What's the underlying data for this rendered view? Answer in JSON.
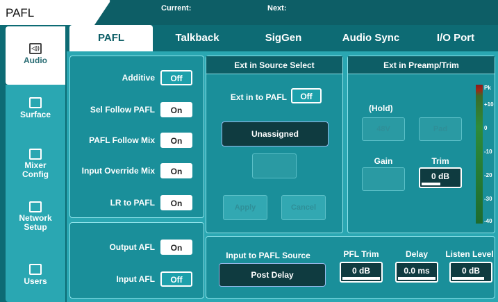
{
  "header": {
    "page_title": "PAFL",
    "current_label": "Current:",
    "next_label": "Next:"
  },
  "sidebar": {
    "items": [
      {
        "label": "Audio",
        "icon": "speaker-icon"
      },
      {
        "label": "Surface",
        "icon": "surface-icon"
      },
      {
        "label": "Mixer Config",
        "icon": "mixer-config-icon"
      },
      {
        "label": "Network Setup",
        "icon": "network-icon"
      },
      {
        "label": "Users",
        "icon": "users-icon"
      }
    ]
  },
  "tabs": [
    "PAFL",
    "Talkback",
    "SigGen",
    "Audio Sync",
    "I/O Port"
  ],
  "pafl_options": {
    "rows": [
      {
        "label": "Additive",
        "value": "Off"
      },
      {
        "label": "Sel Follow PAFL",
        "value": "On"
      },
      {
        "label": "PAFL Follow Mix",
        "value": "On"
      },
      {
        "label": "Input Override Mix",
        "value": "On"
      },
      {
        "label": "LR to PAFL",
        "value": "On"
      }
    ]
  },
  "afl_options": {
    "rows": [
      {
        "label": "Output AFL",
        "value": "On"
      },
      {
        "label": "Input AFL",
        "value": "Off"
      }
    ]
  },
  "ext_source": {
    "title": "Ext in Source Select",
    "ext_in_to_pafl_label": "Ext in to PAFL",
    "ext_in_to_pafl_value": "Off",
    "source_button": "Unassigned",
    "apply_label": "Apply",
    "cancel_label": "Cancel"
  },
  "ext_preamp": {
    "title": "Ext in Preamp/Trim",
    "hold_label": "(Hold)",
    "phantom_label": "48V",
    "pad_label": "Pad",
    "gain_label": "Gain",
    "trim_label": "Trim",
    "trim_value": "0 dB",
    "trim_fill": 0.5
  },
  "meter": {
    "labels": [
      "Pk",
      "+10",
      "0",
      "-10",
      "-20",
      "-30",
      "-40"
    ]
  },
  "bottom": {
    "input_to_pafl_label": "Input to PAFL Source",
    "input_to_pafl_value": "Post Delay",
    "pfl_trim_label": "PFL Trim",
    "pfl_trim_value": "0 dB",
    "pfl_trim_fill": 1.0,
    "delay_label": "Delay",
    "delay_value": "0.0 ms",
    "delay_fill": 1.0,
    "listen_level_label": "Listen Level",
    "listen_level_value": "0 dB",
    "listen_level_fill": 0.85
  }
}
